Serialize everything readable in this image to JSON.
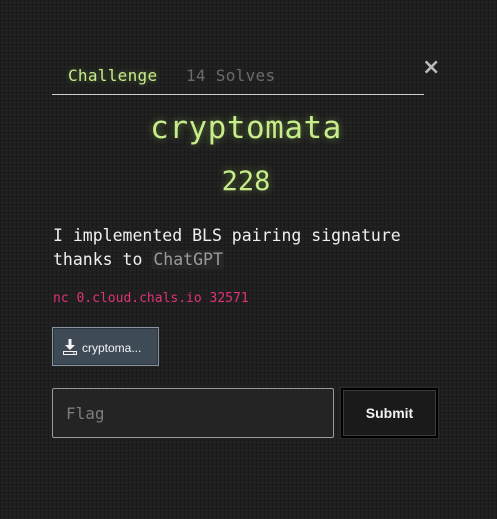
{
  "tabs": [
    {
      "label": "Challenge",
      "active": true
    },
    {
      "label": "14 Solves",
      "active": false
    }
  ],
  "close": {
    "glyph": "×",
    "icon": "close-icon"
  },
  "challenge": {
    "name": "cryptomata",
    "points": "228",
    "description_text": "I implemented BLS pairing signature thanks to ",
    "description_link": "ChatGPT",
    "connection": "nc 0.cloud.chals.io 32571"
  },
  "file": {
    "icon": "download-icon",
    "name": "cryptomata.zip",
    "display_name": "cryptoma..."
  },
  "flag": {
    "placeholder": "Flag",
    "value": ""
  },
  "submit": {
    "label": "Submit"
  },
  "colors": {
    "accent": "#c8ec8a",
    "connection": "#e0317a",
    "background": "#1f1f1f",
    "file_button": "#3e4a56"
  }
}
